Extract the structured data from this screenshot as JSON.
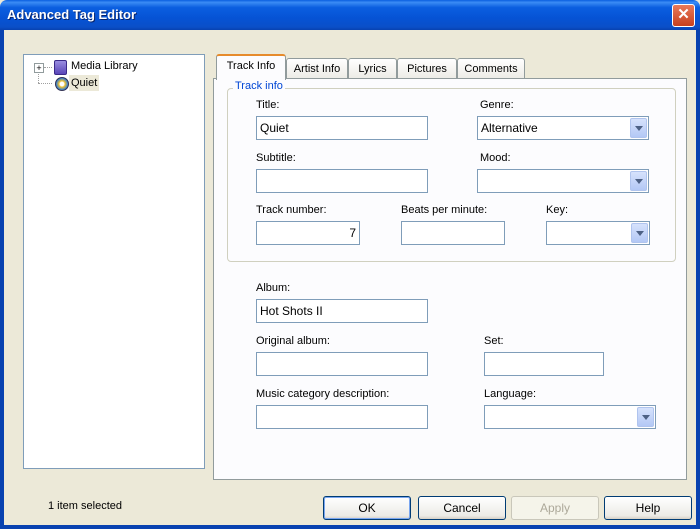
{
  "window": {
    "title": "Advanced Tag Editor"
  },
  "tree": {
    "items": [
      {
        "label": "Media Library",
        "icon": "media-library-icon",
        "expand": "+"
      },
      {
        "label": "Quiet",
        "icon": "music-disc-icon"
      }
    ]
  },
  "tabs": [
    {
      "label": "Track Info"
    },
    {
      "label": "Artist Info"
    },
    {
      "label": "Lyrics"
    },
    {
      "label": "Pictures"
    },
    {
      "label": "Comments"
    }
  ],
  "track_info": {
    "group_label": "Track info",
    "title_label": "Title:",
    "title_value": "Quiet",
    "genre_label": "Genre:",
    "genre_value": "Alternative",
    "subtitle_label": "Subtitle:",
    "subtitle_value": "",
    "mood_label": "Mood:",
    "mood_value": "",
    "track_number_label": "Track number:",
    "track_number_value": "7",
    "bpm_label": "Beats per minute:",
    "bpm_value": "",
    "key_label": "Key:",
    "key_value": ""
  },
  "album": {
    "album_label": "Album:",
    "album_value": "Hot Shots II",
    "original_album_label": "Original album:",
    "original_album_value": "",
    "set_label": "Set:",
    "set_value": "",
    "music_category_label": "Music category description:",
    "music_category_value": "",
    "language_label": "Language:",
    "language_value": ""
  },
  "status": {
    "text": "1 item selected"
  },
  "buttons": {
    "ok": "OK",
    "cancel": "Cancel",
    "apply": "Apply",
    "help": "Help"
  },
  "close_glyph": "✕"
}
